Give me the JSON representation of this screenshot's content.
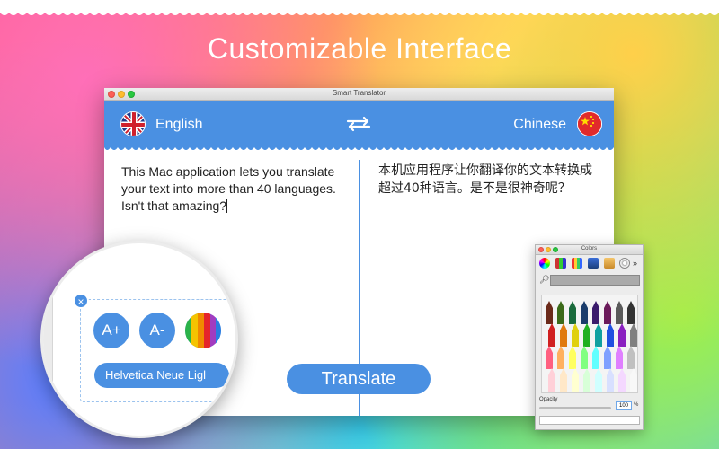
{
  "headline": "Customizable Interface",
  "window": {
    "title": "Smart Translator",
    "source_lang": "English",
    "target_lang": "Chinese",
    "source_text": "This Mac application lets you translate your text into more than 40 languages. Isn't that amazing?",
    "target_text": "本机应用程序让你翻译你的文本转换成超过40种语言。是不是很神奇呢？",
    "translate_label": "Translate"
  },
  "magnifier": {
    "close_glyph": "×",
    "increase_font": "A+",
    "decrease_font": "A-",
    "font_name": "Helvetica Neue Ligl"
  },
  "colors_panel": {
    "title": "Colors",
    "opacity_label": "Opacity",
    "opacity_value": "100",
    "percent": "%",
    "more_glyph": "»"
  },
  "theme": {
    "accent": "#4a90e2",
    "uk_flag": "flag-uk-icon",
    "cn_flag": "flag-china-icon"
  }
}
